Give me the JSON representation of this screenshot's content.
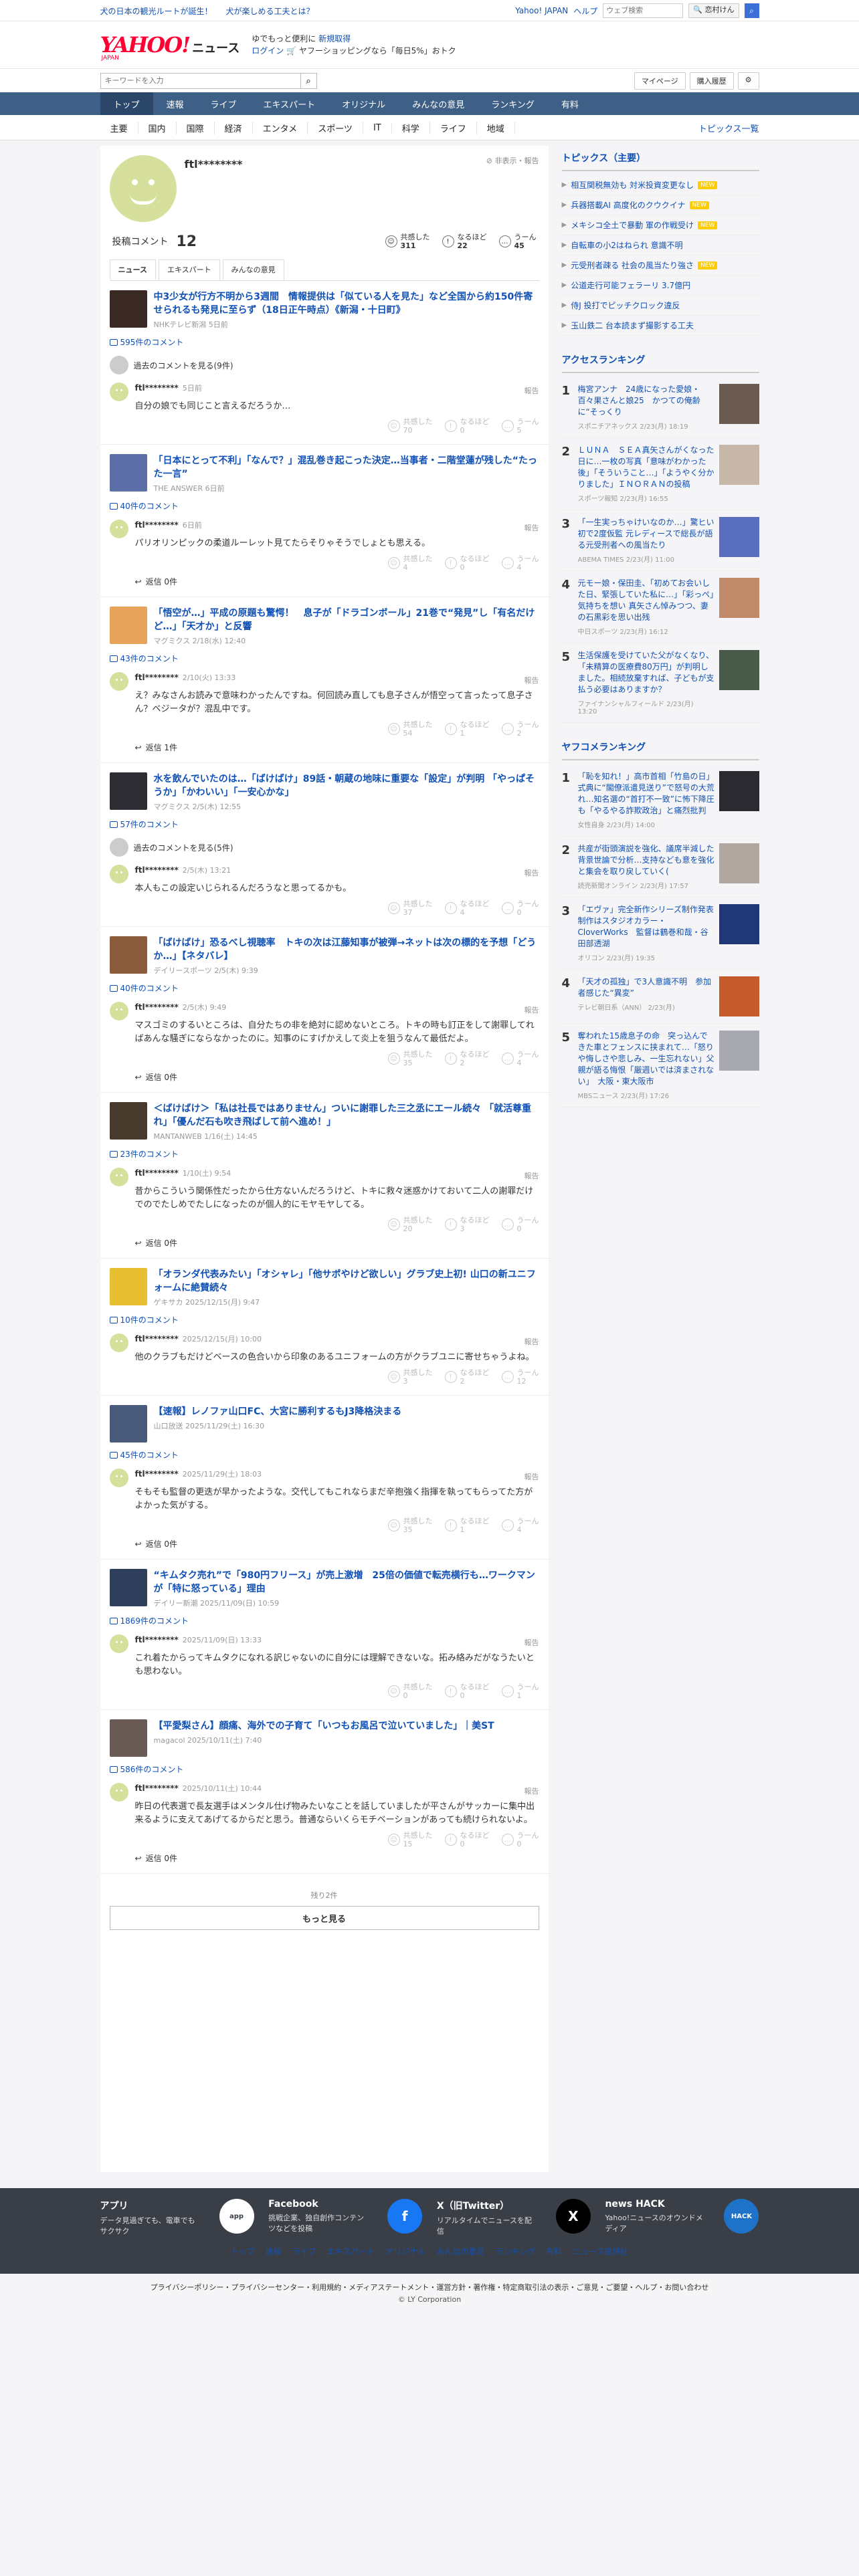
{
  "topbar": {
    "left1": "犬の日本の観光ルートが誕生！",
    "left2": "犬が楽しめる工夫とは？",
    "links": [
      "Yahoo! JAPAN",
      "ヘルプ"
    ],
    "search_placeholder": "ウェブ検索",
    "search_btn": "🔍 恋村けん"
  },
  "header": {
    "logo": "YAHOO!",
    "logo_sub": "JAPAN",
    "news": "ニュース",
    "promo1": "ゆでもっと便利に",
    "promo1_link": "新規取得",
    "promo2_link": "ログイン",
    "promo2": "🛒 ヤフーショッピングなら「毎日5%」おトク"
  },
  "sub": {
    "kw_placeholder": "キーワードを入力",
    "mypage": "マイページ",
    "history": "購入履歴"
  },
  "nav": [
    "トップ",
    "速報",
    "ライブ",
    "エキスパート",
    "オリジナル",
    "みんなの意見",
    "ランキング",
    "有料"
  ],
  "cats": [
    "主要",
    "国内",
    "国際",
    "経済",
    "エンタメ",
    "スポーツ",
    "IT",
    "科学",
    "ライフ",
    "地域"
  ],
  "cat_list": "トピックス一覧",
  "profile": {
    "name": "ftl********",
    "report": "⊘ 非表示・報告",
    "label": "投稿コメント",
    "count": "12",
    "reacts": [
      {
        "label": "共感した",
        "val": "311"
      },
      {
        "label": "なるほど",
        "val": "22"
      },
      {
        "label": "うーん",
        "val": "45"
      }
    ]
  },
  "tabs": [
    "ニュース",
    "エキスパート",
    "みんなの意見"
  ],
  "articles": [
    {
      "title": "中3少女が行方不明から3週間　情報提供は「似ている人を見た」など全国から約150件寄せられるも発見に至らず（18日正午時点）《新潟・十日町》",
      "meta": "NHKテレビ新潟 5日前",
      "count": "595件のコメント",
      "older": "過去のコメントを見る(9件)",
      "cname": "ftl********",
      "cdate": "5日前",
      "text": "自分の娘でも同じこと言えるだろうか…",
      "r": [
        "70",
        "0",
        "5"
      ],
      "reply": ""
    },
    {
      "title": "「日本にとって不利」「なんで？」混乱巻き起こった決定…当事者・二階堂蓮が残した“たった一言”",
      "meta": "THE ANSWER 6日前",
      "count": "40件のコメント",
      "older": "",
      "cname": "ftl********",
      "cdate": "6日前",
      "text": "パリオリンピックの柔道ルーレット見てたらそりゃそうでしょとも思える。",
      "r": [
        "4",
        "0",
        "4"
      ],
      "reply": "返信 0件"
    },
    {
      "title": "「悟空が…」平成の原題も驚愕！　息子が「ドラゴンボール」21巻で“発見”し「有名だけど…」「天才か」と反響",
      "meta": "マグミクス 2/18(水) 12:40",
      "count": "43件のコメント",
      "older": "",
      "cname": "ftl********",
      "cdate": "2/10(火) 13:33",
      "text": "え？みなさんお読みで意味わかったんですね。何回読み直しても息子さんが悟空って言ったって息子さん？ベジータが？混乱中です。",
      "r": [
        "54",
        "1",
        "2"
      ],
      "reply": "返信 1件"
    },
    {
      "title": "水を飲んでいたのは…「ばけばけ」89話・朝蔵の地味に重要な「設定」が判明 「やっぱそうか」「かわいい」「一安心かな」",
      "meta": "マグミクス 2/5(木) 12:55",
      "count": "57件のコメント",
      "older": "過去のコメントを見る(5件)",
      "cname": "ftl********",
      "cdate": "2/5(木) 13:21",
      "text": "本人もこの設定いじられるんだろうなと思ってるかも。",
      "r": [
        "37",
        "4",
        "0"
      ],
      "reply": ""
    },
    {
      "title": "「ばけばけ」恐るべし視聴率　トキの次は江藤知事が被弾→ネットは次の標的を予想「どうか…」【ネタバレ】",
      "meta": "デイリースポーツ 2/5(木) 9:39",
      "count": "40件のコメント",
      "older": "",
      "cname": "ftl********",
      "cdate": "2/5(木) 9:49",
      "text": "マスゴミのするいところは、自分たちの非を絶対に認めないところ。トキの時も訂正をして謝罪してればあんな騒ぎにならなかったのに。知事のにすげかえして炎上を狙うなんて最低だよ。",
      "r": [
        "35",
        "2",
        "4"
      ],
      "reply": "返信 0件"
    },
    {
      "title": "＜ばけばけ＞「私は社長ではありません」ついに謝罪した三之丞にエール続々 「就活尊重れ」「優んだ石も吹き飛ばして前へ進め！」",
      "meta": "MANTANWEB 1/16(土) 14:45",
      "count": "23件のコメント",
      "older": "",
      "cname": "ftl********",
      "cdate": "1/10(土) 9:54",
      "text": "昔からこういう関係性だったから仕方ないんだろうけど、トキに救々迷惑かけておいて二人の謝罪だけでのでたしめでたしになったのが個人的にモヤモヤしてる。",
      "r": [
        "20",
        "3",
        "0"
      ],
      "reply": "返信 0件"
    },
    {
      "title": "「オランダ代表みたい」「オシャレ」「他サポやけど欲しい」グラブ史上初! 山口の新ユニフォームに絶賛続々",
      "meta": "ゲキサカ 2025/12/15(月) 9:47",
      "count": "10件のコメント",
      "older": "",
      "cname": "ftl********",
      "cdate": "2025/12/15(月) 10:00",
      "text": "他のクラブもだけどベースの色合いから印象のあるユニフォームの方がクラブユニに寄せちゃうよね。",
      "r": [
        "3",
        "2",
        "12"
      ],
      "reply": ""
    },
    {
      "title": "【速報】レノファ山口FC、大宮に勝利するもJ3降格決まる",
      "meta": "山口放送 2025/11/29(土) 16:30",
      "count": "45件のコメント",
      "older": "",
      "cname": "ftl********",
      "cdate": "2025/11/29(土) 18:03",
      "text": "そもそも監督の更迭が早かったような。交代してもこれならまだ辛抱強く指揮を執ってもらってた方がよかった気がする。",
      "r": [
        "35",
        "1",
        "4"
      ],
      "reply": "返信 0件"
    },
    {
      "title": "“キムタク売れ”で「980円フリース」が売上激増　25倍の価値で転売横行も…ワークマンが「特に怒っている」理由",
      "meta": "デイリー新潮 2025/11/09(日) 10:59",
      "count": "1869件のコメント",
      "older": "",
      "cname": "ftl********",
      "cdate": "2025/11/09(日) 13:33",
      "text": "これ着たからってキムタクになれる訳じゃないのに自分には理解できないな。拓み絡みだがなうたいとも思わない。",
      "r": [
        "0",
        "0",
        "1"
      ],
      "reply": ""
    },
    {
      "title": "【平愛梨さん】顔痛、海外での子育て「いつもお風呂で泣いていました」｜美ST",
      "meta": "magacol 2025/10/11(土) 7:40",
      "count": "586件のコメント",
      "older": "",
      "cname": "ftl********",
      "cdate": "2025/10/11(土) 10:44",
      "text": "昨日の代表選で長友選手はメンタル仕げ物みたいなことを話していましたが平さんがサッカーに集中出来るように支えてあげてるからだと思う。普通ならいくらモチベーションがあっても続けられないよ。",
      "r": [
        "15",
        "0",
        "0"
      ],
      "reply": "返信 0件"
    }
  ],
  "more": {
    "remain": "残り2件",
    "btn": "もっと見る"
  },
  "topics": {
    "head": "トピックス（主要）",
    "items": [
      {
        "t": "相互関税無効も 対米投資変更なし",
        "new": true
      },
      {
        "t": "兵器搭載AI 高度化のクウクイナ",
        "new": true
      },
      {
        "t": "メキシコ全土で暴動 軍の作戦受け",
        "new": true
      },
      {
        "t": "自転車の小2はねられ 意識不明",
        "new": false
      },
      {
        "t": "元受刑者疎る 社会の風当たり強さ",
        "new": true
      },
      {
        "t": "公道走行可能フェラーリ 3.7億円",
        "new": false
      },
      {
        "t": "侍J 投打でピッチクロック違反",
        "new": false
      },
      {
        "t": "玉山鉄二 台本読まず撮影する工夫",
        "new": false
      }
    ]
  },
  "access": {
    "head": "アクセスランキング",
    "items": [
      {
        "t": "梅宮アンナ　24歳になった愛娘・百々果さんと娘25　かつての俺齢に“そっくり",
        "s": "スポニチアネックス 2/23(月) 18:19"
      },
      {
        "t": "ＬＵＮＡ　ＳＥＡ真矢さんがくなった日に…一枚の写真「意味がわかった後」「そういうこと…」「ようやく分かりました」ＩＮＯＲＡＮの投稿",
        "s": "スポーツ報知 2/23(月) 16:55"
      },
      {
        "t": "「一生実っちゃけいなのか…」驚ヒい初で2度仮監 元レディースで総長が語る元受刑者への風当たり",
        "s": "ABEMA TIMES 2/23(月) 11:00"
      },
      {
        "t": "元モー娘・保田圭、「初めてお会いした日、緊張していた私に…」「彩っぺ」気持ちを想い 真矢さん悼みつつ、妻の石黒彩を思い出残",
        "s": "中日スポーツ 2/23(月) 16:12"
      },
      {
        "t": "生活保護を受けていた父がなくなり、「未精算の医療費80万円」が判明しました。相続放棄すれば、子どもが支払う必要はありますか？",
        "s": "ファイナンシャルフィールド 2/23(月) 13:20"
      }
    ]
  },
  "yafuko": {
    "head": "ヤフコメランキング",
    "items": [
      {
        "t": "「恥を知れ！」高市首相「竹島の日」式典に“閣僚派遣見送り”で怒号の大荒れ…知名選の“首打不一致”に怖下降圧も「やるやる詐欺政治」と痛烈批判",
        "s": "女性自身 2/23(月) 14:00"
      },
      {
        "t": "共産が街頭演説を強化、議席半減した背景世論で分析…支持なども意を強化と集会を取り戻していく(",
        "s": "読売新聞オンライン 2/23(月) 17:57"
      },
      {
        "t": "「エヴァ」完全新作シリーズ制作発表　制作はスタジオカラー・CloverWorks　監督は鶴巻和哉・谷田部透湖",
        "s": "オリコン 2/23(月) 19:35"
      },
      {
        "t": "「天才の孤独」で3人意識不明　参加者感じた“異変”",
        "s": "テレビ朝日系（ANN） 2/23(月)"
      },
      {
        "t": "奪われた15歳息子の命　突っ込んできた車とフェンスに挟まれて…「怒りや悔しさや悲しみ、一生忘れない」父親が語る悔恨「厳週いでは済まされない」　大阪・東大阪市",
        "s": "MBSニュース 2/23(月) 17:26"
      }
    ]
  },
  "footer": {
    "cols": [
      {
        "t": "アプリ",
        "d": "データ見過ぎても、電車でもサクサク",
        "ic": "app"
      },
      {
        "t": "Facebook",
        "d": "挑戦企業、独自創作コンテンツなどを投稿",
        "ic": "f"
      },
      {
        "t": "X（旧Twitter）",
        "d": "リアルタイムでニュースを配信",
        "ic": "X"
      },
      {
        "t": "news HACK",
        "d": "Yahoo!ニュースのオウンドメディア",
        "ic": "HACK"
      }
    ],
    "links": [
      "トップ",
      "速報",
      "ライブ",
      "エキスパート",
      "オリジナル",
      "みんなの意見",
      "ランキング",
      "有料",
      "ニュース提供社"
    ],
    "legal": "プライバシーポリシー・プライバシーセンター・利用規約・メディアステートメント・運営方針・著作権・特定商取引法の表示・ご意見・ご要望・ヘルプ・お問い合わせ",
    "copy": "© LY Corporation"
  }
}
